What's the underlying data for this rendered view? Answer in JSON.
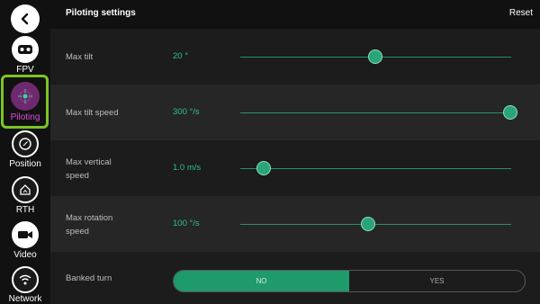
{
  "header": {
    "title": "Piloting settings",
    "reset_label": "Reset"
  },
  "sidebar": {
    "items": [
      {
        "label": "FPV",
        "icon": "vr-headset-icon"
      },
      {
        "label": "Piloting",
        "icon": "piloting-icon",
        "active": true
      },
      {
        "label": "Position",
        "icon": "compass-icon"
      },
      {
        "label": "RTH",
        "icon": "home-icon"
      },
      {
        "label": "Video",
        "icon": "video-camera-icon"
      },
      {
        "label": "Network",
        "icon": "wifi-icon"
      }
    ]
  },
  "settings": {
    "max_tilt": {
      "label": "Max tilt",
      "value": "20 °",
      "slider_fraction": 0.5
    },
    "max_tilt_speed": {
      "label": "Max tilt speed",
      "value": "300 °/s",
      "slider_fraction": 1.0
    },
    "max_vertical_speed": {
      "label_line1": "Max vertical",
      "label_line2": "speed",
      "value": "1.0 m/s",
      "slider_fraction": 0.09
    },
    "max_rotation_speed": {
      "label_line1": "Max rotation",
      "label_line2": "speed",
      "value": "100 °/s",
      "slider_fraction": 0.47
    },
    "banked_turn": {
      "label": "Banked turn",
      "options": [
        "NO",
        "YES"
      ],
      "selected": "NO"
    }
  },
  "colors": {
    "accent": "#2cc28a",
    "active_nav_border": "#7cc520",
    "active_nav_text": "#e04bd8"
  }
}
